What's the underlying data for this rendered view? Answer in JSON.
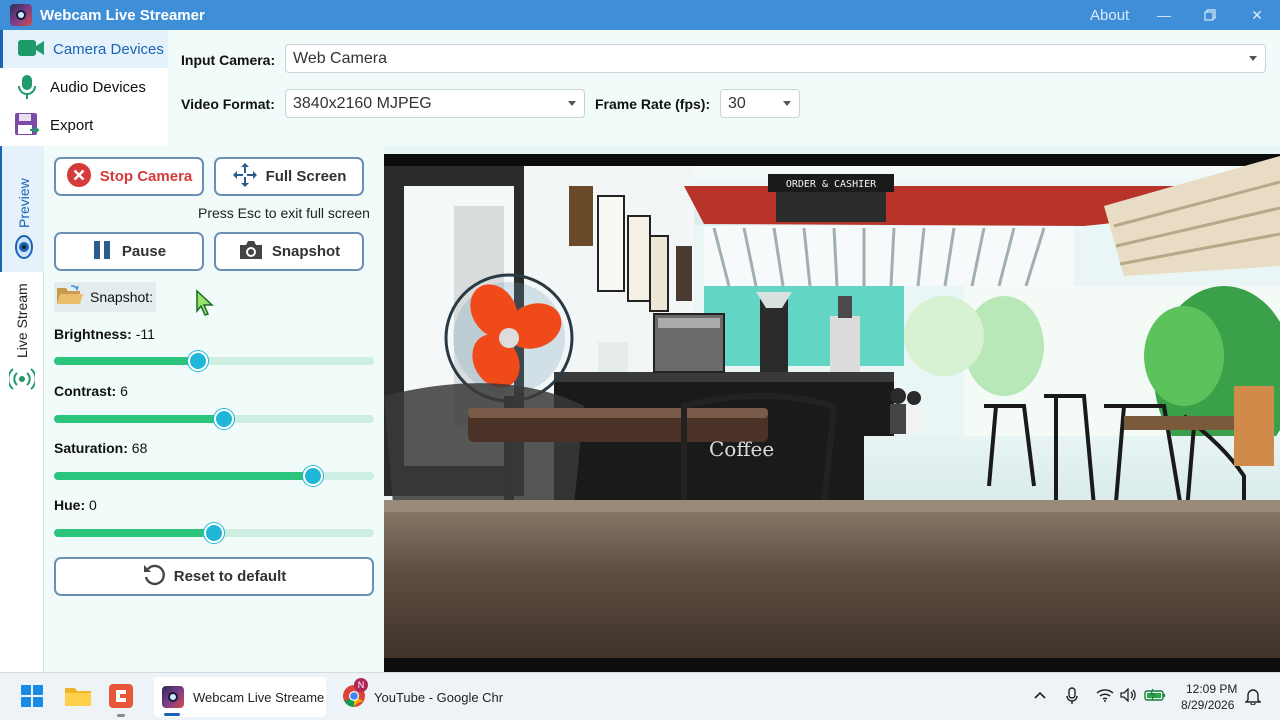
{
  "window": {
    "title": "Webcam Live Streamer",
    "about": "About"
  },
  "nav": {
    "items": [
      {
        "label": "Camera Devices"
      },
      {
        "label": "Audio Devices"
      },
      {
        "label": "Export"
      }
    ]
  },
  "settings": {
    "input_camera_label": "Input Camera:",
    "input_camera_value": "Web Camera",
    "video_format_label": "Video Format:",
    "video_format_value": "3840x2160 MJPEG",
    "frame_rate_label": "Frame Rate (fps):",
    "frame_rate_value": "30"
  },
  "tabs": {
    "preview": "Preview",
    "live_stream": "Live Stream"
  },
  "controls": {
    "stop_camera": "Stop Camera",
    "full_screen": "Full Screen",
    "fullscreen_hint": "Press Esc to exit full screen",
    "pause": "Pause",
    "snapshot": "Snapshot",
    "snapshot_folder": "Snapshot:",
    "reset": "Reset to default"
  },
  "sliders": {
    "brightness": {
      "label": "Brightness:",
      "value": "-11",
      "level": 0.45
    },
    "contrast": {
      "label": "Contrast:",
      "value": "6",
      "level": 0.53
    },
    "saturation": {
      "label": "Saturation:",
      "value": "68",
      "level": 0.81
    },
    "hue": {
      "label": "Hue:",
      "value": "0",
      "level": 0.5
    }
  },
  "video": {
    "sign_text": "ORDER & CASHIER",
    "cup_text": "Coffee"
  },
  "taskbar": {
    "app1": "Webcam Live Streame",
    "app2": "YouTube - Google Chr",
    "badge": "N",
    "time": "12:09 PM",
    "date": "8/29/2026"
  },
  "colors": {
    "accent": "#1a64b5",
    "titlebar": "#3f8fd8",
    "slider_fill": "#2bc47c",
    "slider_thumb": "#20b6d8",
    "stop_red": "#d63b3b"
  }
}
